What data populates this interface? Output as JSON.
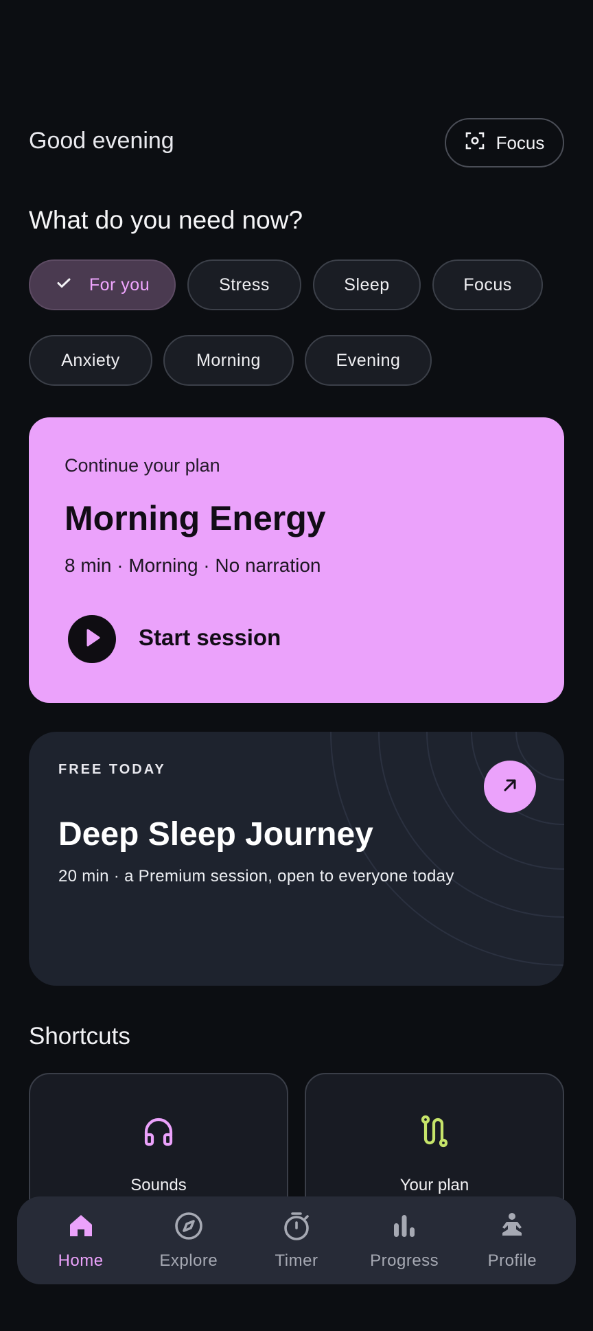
{
  "header": {
    "greeting": "Good evening",
    "focus_button": {
      "label": "Focus",
      "icon": "focus-frame-icon"
    }
  },
  "question": "What do you need now?",
  "chips": [
    {
      "label": "For you",
      "selected": true,
      "icon": "check-icon"
    },
    {
      "label": "Stress",
      "selected": false
    },
    {
      "label": "Sleep",
      "selected": false
    },
    {
      "label": "Focus",
      "selected": false
    },
    {
      "label": "Anxiety",
      "selected": false
    },
    {
      "label": "Morning",
      "selected": false
    },
    {
      "label": "Evening",
      "selected": false
    }
  ],
  "plan_card": {
    "kicker": "Continue your plan",
    "title": "Morning Energy",
    "meta": "8 min · Morning · No narration",
    "action_label": "Start session",
    "action_icon": "play-icon",
    "background": "#eba2fb"
  },
  "free_card": {
    "kicker": "FREE TODAY",
    "title": "Deep Sleep Journey",
    "meta": "20 min · a Premium session, open to everyone today",
    "action_icon": "arrow-up-right-icon"
  },
  "shortcuts": {
    "heading": "Shortcuts",
    "items": [
      {
        "label": "Sounds",
        "icon": "headphones-icon",
        "color": "#eba2fb"
      },
      {
        "label": "Your plan",
        "icon": "route-icon",
        "color": "#c6e46a"
      }
    ]
  },
  "nav": {
    "items": [
      {
        "label": "Home",
        "icon": "home-icon",
        "active": true
      },
      {
        "label": "Explore",
        "icon": "compass-icon",
        "active": false
      },
      {
        "label": "Timer",
        "icon": "timer-icon",
        "active": false
      },
      {
        "label": "Progress",
        "icon": "bar-chart-icon",
        "active": false
      },
      {
        "label": "Profile",
        "icon": "meditation-person-icon",
        "active": false
      }
    ]
  },
  "colors": {
    "background": "#0c0e12",
    "accent": "#eba2fb",
    "card": "#1e232e",
    "nav": "#272b37"
  }
}
